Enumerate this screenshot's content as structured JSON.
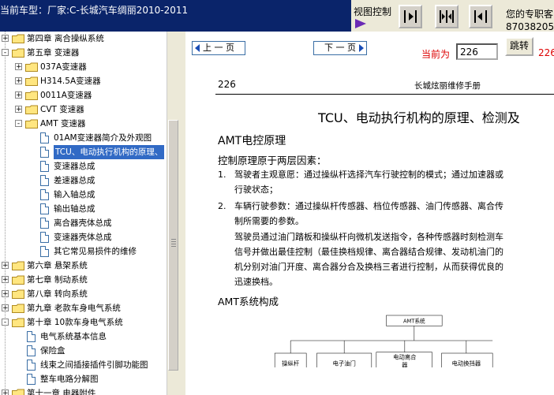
{
  "header": {
    "title_prefix": "当前车型：",
    "title_text": "厂家:C-长城汽车绸丽2010-2011",
    "view_control_label": "视图控制",
    "contact_line1": "您的专职客",
    "contact_line2": "87038205"
  },
  "toolbar": {
    "btn_left_icon": "panel-left-icon",
    "btn_both_icon": "panel-both-icon",
    "btn_right_icon": "panel-right-icon"
  },
  "tree": {
    "items": [
      {
        "label": "第四章  离合操纵系统",
        "type": "folder",
        "expander": "+"
      },
      {
        "label": "第五章  变速器",
        "type": "folder",
        "expander": "-"
      },
      {
        "label": "037A变速器",
        "type": "folder",
        "expander": "+"
      },
      {
        "label": "H314.5A变速器",
        "type": "folder",
        "expander": "+"
      },
      {
        "label": "0011A变速器",
        "type": "folder",
        "expander": "+"
      },
      {
        "label": "CVT 变速器",
        "type": "folder",
        "expander": "+"
      },
      {
        "label": "AMT 变速器",
        "type": "folder",
        "expander": "-"
      },
      {
        "label": "01AM变速器简介及外观图",
        "type": "page"
      },
      {
        "label": "TCU、电动执行机构的原理、",
        "type": "page",
        "selected": true
      },
      {
        "label": "变速器总成",
        "type": "page"
      },
      {
        "label": "差速器总成",
        "type": "page"
      },
      {
        "label": "输入轴总成",
        "type": "page"
      },
      {
        "label": "输出轴总成",
        "type": "page"
      },
      {
        "label": "离合器壳体总成",
        "type": "page"
      },
      {
        "label": "变速器壳体总成",
        "type": "page"
      },
      {
        "label": "其它常见易损件的维修",
        "type": "page"
      },
      {
        "label": "第六章  悬架系统",
        "type": "folder",
        "expander": "+"
      },
      {
        "label": "第七章  制动系统",
        "type": "folder",
        "expander": "+"
      },
      {
        "label": "第八章  转向系统",
        "type": "folder",
        "expander": "+"
      },
      {
        "label": "第九章  老款车身电气系统",
        "type": "folder",
        "expander": "+"
      },
      {
        "label": "第十章  10款车身电气系统",
        "type": "folder",
        "expander": "-"
      },
      {
        "label": "电气系统基本信息",
        "type": "page"
      },
      {
        "label": "保险盒",
        "type": "page"
      },
      {
        "label": "线束之间插接插件引脚功能图",
        "type": "page"
      },
      {
        "label": "整车电路分解图",
        "type": "page"
      },
      {
        "label": "第十一章  电器附件",
        "type": "folder",
        "expander": "+"
      }
    ]
  },
  "nav": {
    "prev_label": "上 一 页",
    "next_label": "下 一 页",
    "current_label": "当前为",
    "page_value": "226",
    "go_label": "跳转",
    "total_text": "226"
  },
  "doc": {
    "page_number": "226",
    "book_title": "长城炫丽维修手册",
    "title": "TCU、电动执行机构的原理、检测及",
    "section1": "AMT电控原理",
    "section1_sub": "控制原理原于两层因素：",
    "p1_num": "1.",
    "p1_line1": "驾驶者主观意愿：通过操纵杆选择汽车行驶控制的模式；通过加速器或",
    "p1_line2": "行驶状态；",
    "p2_num": "2.",
    "p2_line1": "车辆行驶参数：通过操纵杆传感器、档位传感器、油门传感器、离合传",
    "p2_line2": "制所需要的参数。",
    "p3_line1": "驾驶员通过油门踏板和操纵杆向微机发送指令，各种传感器时刻检测车",
    "p3_line2": "信号并做出最佳控制（最佳换档规律、离合器结合规律、发动机油门的",
    "p3_line3": "机分别对油门开度、离合器分合及换档三者进行控制，从而获得优良的",
    "p3_line4": "迅速换档。",
    "section2": "AMT系统构成",
    "diagram_root": "AMT系统",
    "diagram_box1": "操纵杆",
    "diagram_box2": "电子油门",
    "diagram_box3_line1": "电动离合",
    "diagram_box3_line2": "器",
    "diagram_box4": "电动换挡器"
  }
}
